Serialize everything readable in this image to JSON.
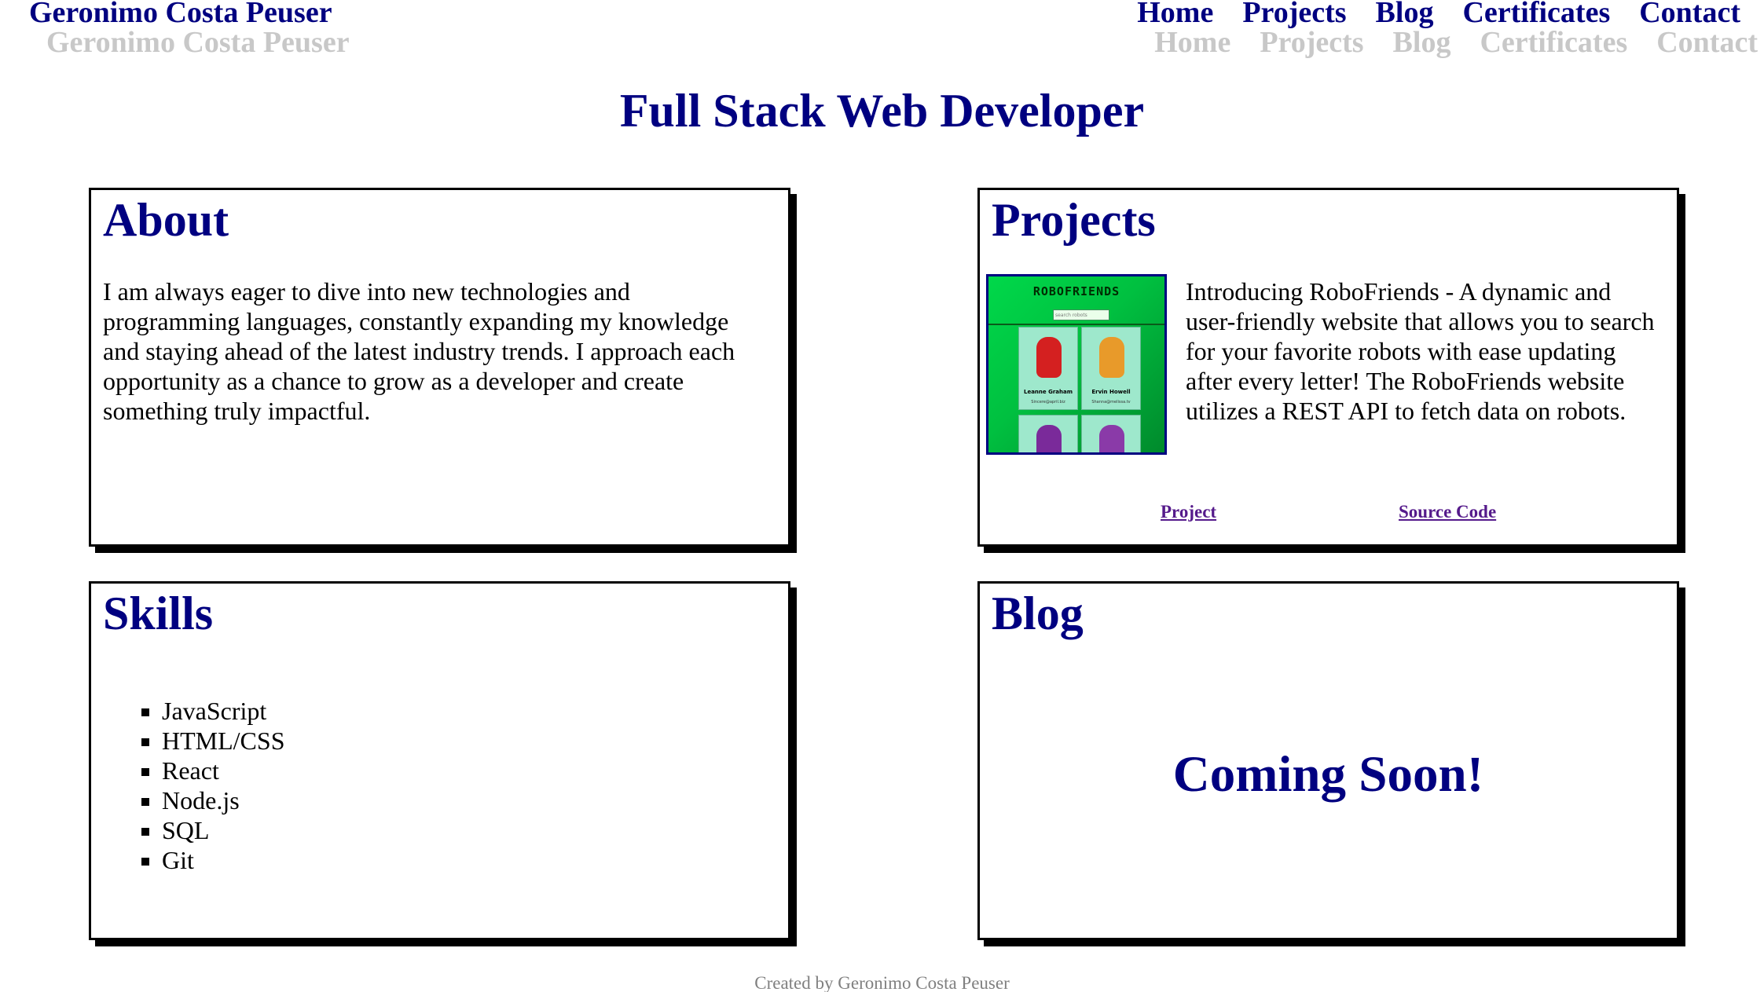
{
  "header": {
    "brand": "Geronimo Costa Peuser",
    "nav": [
      "Home",
      "Projects",
      "Blog",
      "Certificates",
      "Contact"
    ]
  },
  "headline": "Full Stack Web Developer",
  "about": {
    "title": "About",
    "text": "I am always eager to dive into new technologies and programming languages, constantly expanding my knowledge and staying ahead of the latest industry trends. I approach each opportunity as a chance to grow as a developer and create something truly impactful."
  },
  "projects": {
    "title": "Projects",
    "thumbnail": {
      "title": "ROBOFRIENDS",
      "search_placeholder": "search robots",
      "robots": [
        {
          "name": "Leanne Graham",
          "email": "Sincere@april.biz"
        },
        {
          "name": "Ervin Howell",
          "email": "Shanna@melissa.tv"
        }
      ]
    },
    "description": "Introducing RoboFriends - A dynamic and user-friendly website that allows you to search for your favorite robots with ease updating after every letter! The RoboFriends website utilizes a REST API to fetch data on robots.",
    "project_link": "Project",
    "source_link": "Source Code"
  },
  "skills": {
    "title": "Skills",
    "items": [
      "JavaScript",
      "HTML/CSS",
      "React",
      "Node.js",
      "SQL",
      "Git"
    ]
  },
  "blog": {
    "title": "Blog",
    "status": "Coming Soon!"
  },
  "footer": "Created by Geronimo Costa Peuser",
  "colors": {
    "primary": "#000080",
    "shadow_text": "#c8c8c8",
    "link_visited": "#551a8b",
    "thumbnail_green": "#00c040"
  }
}
